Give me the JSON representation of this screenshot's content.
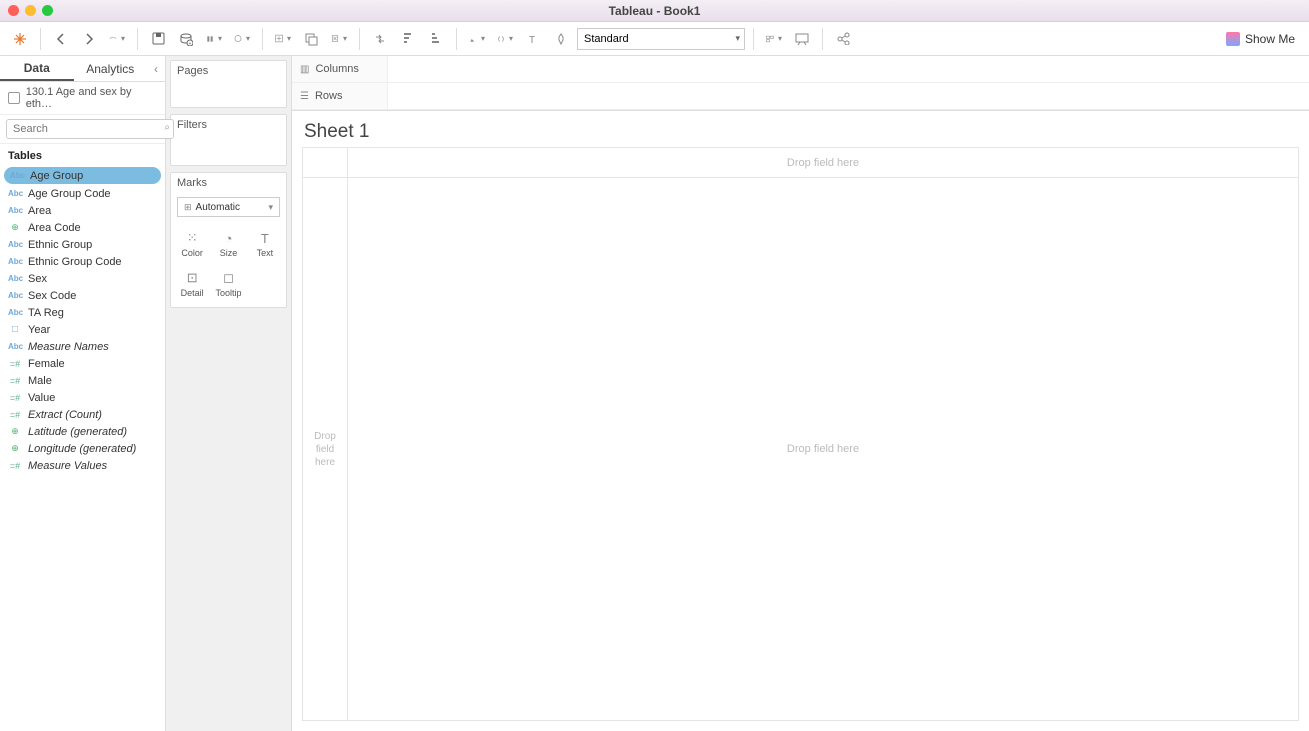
{
  "window": {
    "title": "Tableau - Book1"
  },
  "toolbar": {
    "fit": "Standard",
    "showme": "Show Me"
  },
  "sidebar": {
    "tabs": {
      "data": "Data",
      "analytics": "Analytics"
    },
    "datasource": "130.1 Age and sex by eth…",
    "search_placeholder": "Search",
    "tables_header": "Tables",
    "fields": [
      {
        "icon": "abc",
        "label": "Age Group",
        "selected": true
      },
      {
        "icon": "abc",
        "label": "Age Group Code"
      },
      {
        "icon": "abc",
        "label": "Area"
      },
      {
        "icon": "geo",
        "label": "Area Code"
      },
      {
        "icon": "abc",
        "label": "Ethnic Group"
      },
      {
        "icon": "abc",
        "label": "Ethnic Group Code"
      },
      {
        "icon": "abc",
        "label": "Sex"
      },
      {
        "icon": "abc",
        "label": "Sex Code"
      },
      {
        "icon": "abc",
        "label": "TA Reg"
      },
      {
        "icon": "cal",
        "label": "Year"
      },
      {
        "icon": "abc",
        "label": "Measure Names",
        "italic": true
      },
      {
        "icon": "num",
        "label": "Female"
      },
      {
        "icon": "num",
        "label": "Male"
      },
      {
        "icon": "num",
        "label": "Value"
      },
      {
        "icon": "num",
        "label": "Extract (Count)",
        "italic": true
      },
      {
        "icon": "geo",
        "label": "Latitude (generated)",
        "italic": true
      },
      {
        "icon": "geo",
        "label": "Longitude (generated)",
        "italic": true
      },
      {
        "icon": "num",
        "label": "Measure Values",
        "italic": true
      }
    ]
  },
  "shelves": {
    "pages": "Pages",
    "filters": "Filters",
    "marks": "Marks",
    "marks_type": "Automatic",
    "mark_buttons": {
      "color": "Color",
      "size": "Size",
      "text": "Text",
      "detail": "Detail",
      "tooltip": "Tooltip"
    },
    "columns": "Columns",
    "rows": "Rows"
  },
  "sheet": {
    "title": "Sheet 1",
    "drop_here": "Drop field here",
    "drop_here_vertical": "Drop\nfield\nhere"
  }
}
